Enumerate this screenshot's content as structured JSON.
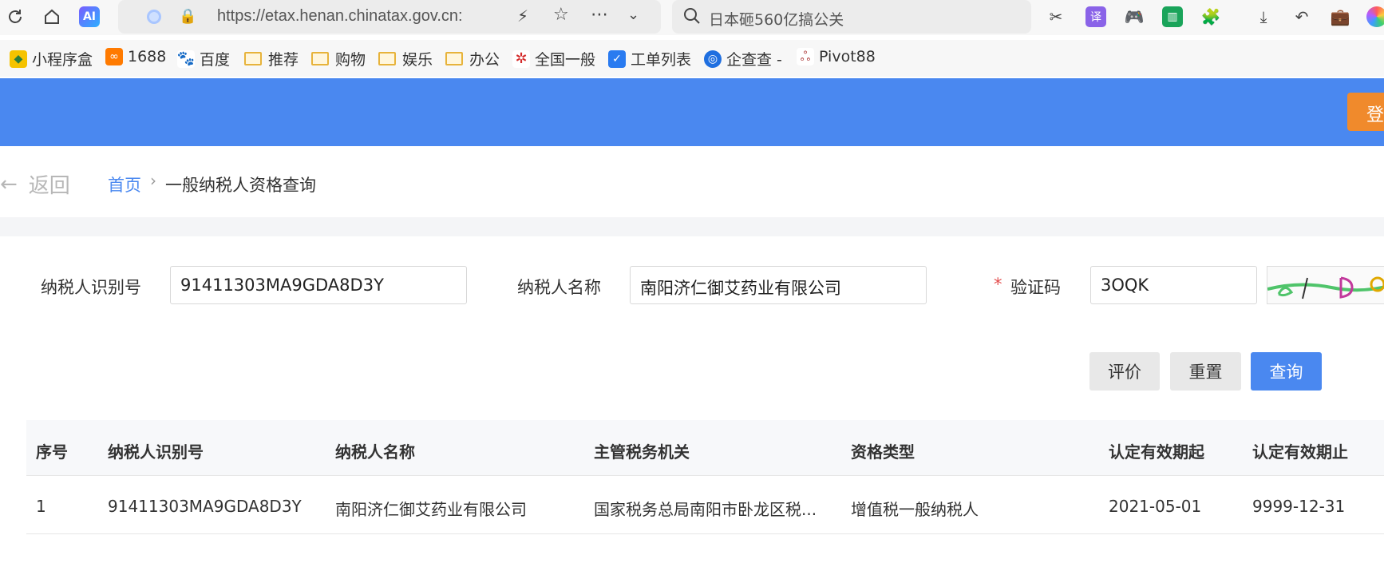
{
  "browser": {
    "url": "https://etax.henan.chinatax.gov.cn:",
    "search_placeholder": "日本砸560亿搞公关",
    "ai_badge": "AI"
  },
  "bookmarks": [
    {
      "label": "小程序盒"
    },
    {
      "label": "1688"
    },
    {
      "label": "百度"
    },
    {
      "label": "推荐"
    },
    {
      "label": "购物"
    },
    {
      "label": "娱乐"
    },
    {
      "label": "办公"
    },
    {
      "label": "全国一般"
    },
    {
      "label": "工单列表"
    },
    {
      "label": "企查查 -"
    },
    {
      "label": "Pivot88"
    }
  ],
  "header": {
    "login_label": "登"
  },
  "breadcrumb": {
    "back_label": "返回",
    "home": "首页",
    "separator": "›",
    "current": "一般纳税人资格查询"
  },
  "form": {
    "taxpayer_id_label": "纳税人识别号",
    "taxpayer_id_value": "91411303MA9GDA8D3Y",
    "taxpayer_name_label": "纳税人名称",
    "taxpayer_name_value": "南阳济仁御艾药业有限公司",
    "captcha_label": "验证码",
    "captcha_required": "*",
    "captcha_value": "3OQK"
  },
  "buttons": {
    "evaluate": "评价",
    "reset": "重置",
    "query": "查询"
  },
  "table": {
    "headers": [
      "序号",
      "纳税人识别号",
      "纳税人名称",
      "主管税务机关",
      "资格类型",
      "认定有效期起",
      "认定有效期止"
    ],
    "rows": [
      [
        "1",
        "91411303MA9GDA8D3Y",
        "南阳济仁御艾药业有限公司",
        "国家税务总局南阳市卧龙区税...",
        "增值税一般纳税人",
        "2021-05-01",
        "9999-12-31"
      ]
    ]
  },
  "colors": {
    "header_blue": "#4a88f0",
    "login_orange": "#f08a2c"
  }
}
